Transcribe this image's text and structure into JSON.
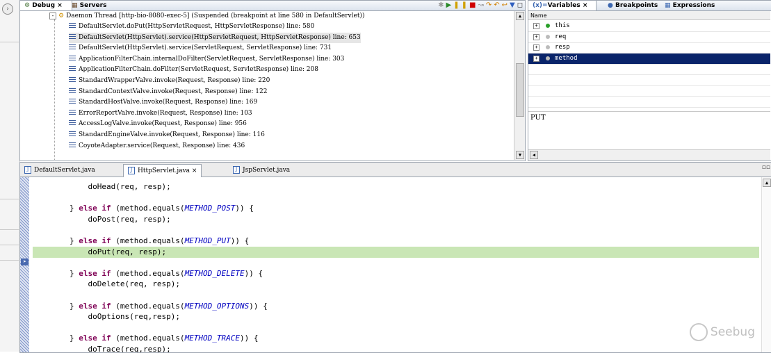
{
  "debug_view": {
    "tab_debug": "Debug",
    "tab_servers": "Servers",
    "thread_label": "Daemon Thread [http-bio-8080-exec-5] (Suspended (breakpoint at line 580 in DefaultServlet))",
    "frames": [
      "DefaultServlet.doPut(HttpServletRequest, HttpServletResponse) line: 580",
      "DefaultServlet(HttpServlet).service(HttpServletRequest, HttpServletResponse) line: 653",
      "DefaultServlet(HttpServlet).service(ServletRequest, ServletResponse) line: 731",
      "ApplicationFilterChain.internalDoFilter(ServletRequest, ServletResponse) line: 303",
      "ApplicationFilterChain.doFilter(ServletRequest, ServletResponse) line: 208",
      "StandardWrapperValve.invoke(Request, Response) line: 220",
      "StandardContextValve.invoke(Request, Response) line: 122",
      "StandardHostValve.invoke(Request, Response) line: 169",
      "ErrorReportValve.invoke(Request, Response) line: 103",
      "AccessLogValve.invoke(Request, Response) line: 956",
      "StandardEngineValve.invoke(Request, Response) line: 116",
      "CoyoteAdapter.service(Request, Response) line: 436"
    ],
    "selected_frame_index": 1
  },
  "variables_view": {
    "tab_variables": "Variables",
    "tab_breakpoints": "Breakpoints",
    "tab_expressions": "Expressions",
    "column_name": "Name",
    "variables": [
      {
        "name": "this",
        "icon": "green-circle-icon"
      },
      {
        "name": "req",
        "icon": "gray-circle-icon"
      },
      {
        "name": "resp",
        "icon": "gray-circle-icon"
      },
      {
        "name": "method",
        "icon": "gray-circle-icon",
        "selected": true
      }
    ],
    "detail_value": "PUT"
  },
  "editor": {
    "tabs": [
      "DefaultServlet.java",
      "HttpServlet.java",
      "JspServlet.java"
    ],
    "active_tab_index": 1,
    "lines": [
      {
        "indent": "            ",
        "parts": [
          {
            "t": "doHead(req, resp);",
            "c": ""
          }
        ]
      },
      {
        "indent": "",
        "parts": []
      },
      {
        "indent": "        ",
        "parts": [
          {
            "t": "} ",
            "c": ""
          },
          {
            "t": "else if",
            "c": "kw"
          },
          {
            "t": " (method.equals(",
            "c": ""
          },
          {
            "t": "METHOD_POST",
            "c": "const"
          },
          {
            "t": ")) {",
            "c": ""
          }
        ]
      },
      {
        "indent": "            ",
        "parts": [
          {
            "t": "doPost(req, resp);",
            "c": ""
          }
        ]
      },
      {
        "indent": "",
        "parts": []
      },
      {
        "indent": "        ",
        "parts": [
          {
            "t": "} ",
            "c": ""
          },
          {
            "t": "else if",
            "c": "kw"
          },
          {
            "t": " (method.equals(",
            "c": ""
          },
          {
            "t": "METHOD_PUT",
            "c": "const"
          },
          {
            "t": ")) {",
            "c": ""
          }
        ]
      },
      {
        "indent": "            ",
        "parts": [
          {
            "t": "doPut(req, resp);",
            "c": ""
          }
        ],
        "current": true
      },
      {
        "indent": "",
        "parts": []
      },
      {
        "indent": "        ",
        "parts": [
          {
            "t": "} ",
            "c": ""
          },
          {
            "t": "else if",
            "c": "kw"
          },
          {
            "t": " (method.equals(",
            "c": ""
          },
          {
            "t": "METHOD_DELETE",
            "c": "const"
          },
          {
            "t": ")) {",
            "c": ""
          }
        ]
      },
      {
        "indent": "            ",
        "parts": [
          {
            "t": "doDelete(req, resp);",
            "c": ""
          }
        ]
      },
      {
        "indent": "",
        "parts": []
      },
      {
        "indent": "        ",
        "parts": [
          {
            "t": "} ",
            "c": ""
          },
          {
            "t": "else if",
            "c": "kw"
          },
          {
            "t": " (method.equals(",
            "c": ""
          },
          {
            "t": "METHOD_OPTIONS",
            "c": "const"
          },
          {
            "t": ")) {",
            "c": ""
          }
        ]
      },
      {
        "indent": "            ",
        "parts": [
          {
            "t": "doOptions(req,resp);",
            "c": ""
          }
        ]
      },
      {
        "indent": "",
        "parts": []
      },
      {
        "indent": "        ",
        "parts": [
          {
            "t": "} ",
            "c": ""
          },
          {
            "t": "else if",
            "c": "kw"
          },
          {
            "t": " (method.equals(",
            "c": ""
          },
          {
            "t": "METHOD_TRACE",
            "c": "const"
          },
          {
            "t": ")) {",
            "c": ""
          }
        ]
      },
      {
        "indent": "            ",
        "parts": [
          {
            "t": "doTrace(req,resp);",
            "c": ""
          }
        ]
      }
    ]
  },
  "watermark": "Seebug",
  "colors": {
    "selection": "#0a246a",
    "current_line": "#c9e6b5",
    "keyword": "#7f0055",
    "constant": "#0000c0"
  }
}
